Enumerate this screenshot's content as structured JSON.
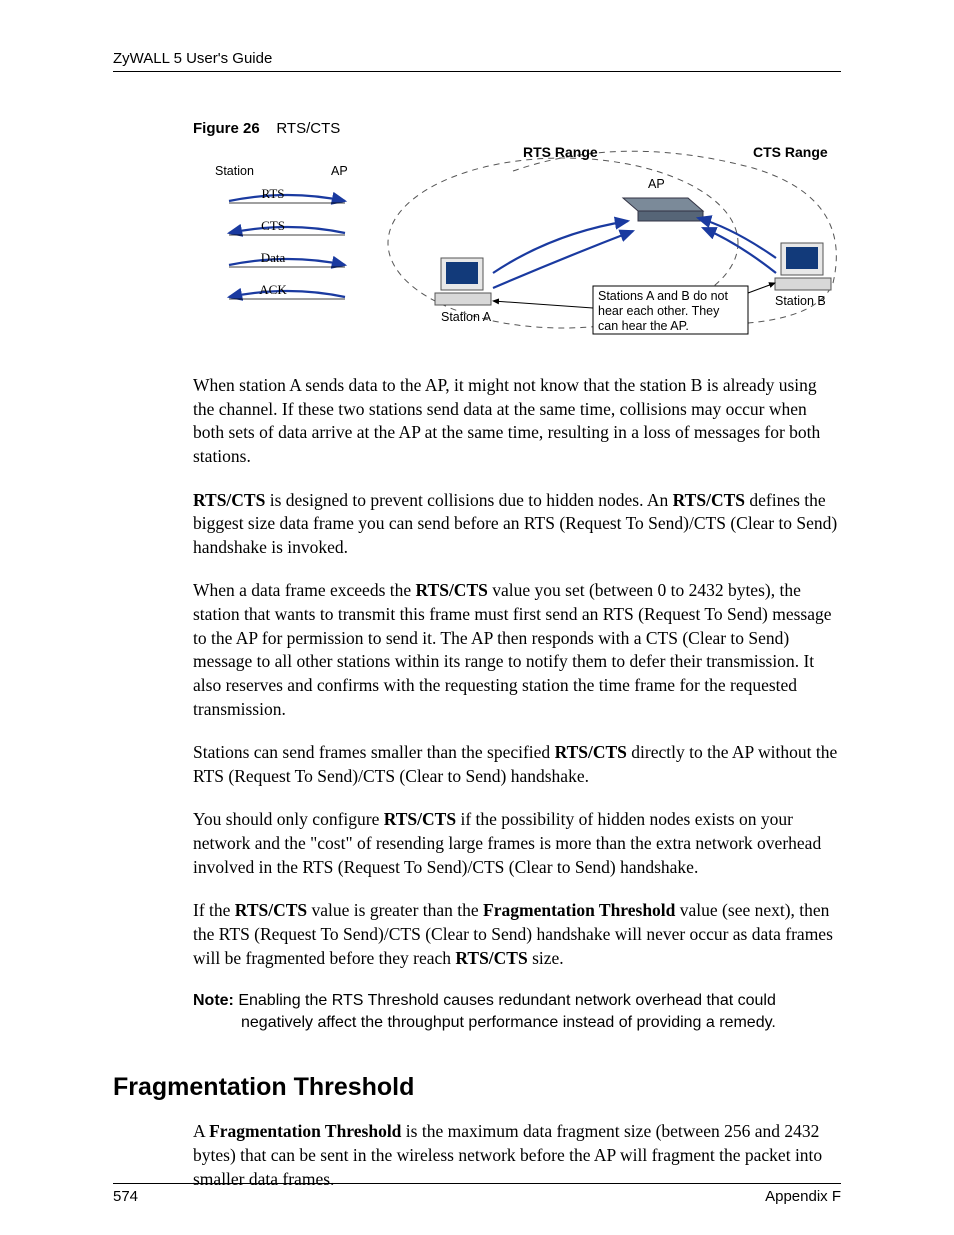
{
  "header": {
    "title": "ZyWALL 5 User's Guide"
  },
  "figure": {
    "label": "Figure 26",
    "title": "RTS/CTS",
    "left": {
      "station": "Station",
      "ap": "AP",
      "seq": [
        "RTS",
        "CTS",
        "Data",
        "ACK"
      ]
    },
    "right": {
      "rts_range": "RTS Range",
      "cts_range": "CTS Range",
      "ap": "AP",
      "station_a": "Station  A",
      "station_b": "Station B",
      "note_l1": "Stations A and B do not",
      "note_l2": "hear each other. They",
      "note_l3": "can hear the AP."
    }
  },
  "paragraphs": {
    "p1": "When station A sends data to the AP, it might not know that the station B is already using the channel. If these two stations send data at the same time, collisions may occur when both sets of data arrive at the AP at the same time, resulting in a loss of messages for both stations.",
    "p2a": "RTS/CTS",
    "p2b": " is designed to prevent collisions due to hidden nodes. An ",
    "p2c": "RTS/CTS",
    "p2d": " defines the biggest size data frame you can send before an RTS (Request To Send)/CTS (Clear to Send) handshake is invoked.",
    "p3a": "When a data frame exceeds the ",
    "p3b": "RTS/CTS",
    "p3c": " value you set (between 0 to 2432 bytes), the station that wants to transmit this frame must first send an RTS (Request To Send) message to the AP for permission to send it. The AP then responds with a CTS (Clear to Send) message to all other stations within its range to notify them to defer their transmission. It also reserves and confirms with the requesting station the time frame for the requested transmission.",
    "p4a": "Stations can send frames smaller than the specified ",
    "p4b": "RTS/CTS",
    "p4c": " directly to the AP without the RTS (Request To Send)/CTS (Clear to Send) handshake.",
    "p5a": "You should only configure ",
    "p5b": "RTS/CTS",
    "p5c": " if the possibility of hidden nodes exists on your network and the \"cost\" of resending large frames is more than the extra network overhead involved in the RTS (Request To Send)/CTS (Clear to Send) handshake.",
    "p6a": "If the ",
    "p6b": "RTS/CTS",
    "p6c": " value is greater than the ",
    "p6d": "Fragmentation Threshold",
    "p6e": " value (see next), then the RTS (Request To Send)/CTS (Clear to Send) handshake will never occur as data frames will be fragmented before they reach ",
    "p6f": "RTS/CTS",
    "p6g": " size.",
    "note_label": "Note: ",
    "note_text": "Enabling the RTS Threshold causes redundant network overhead that could negatively affect the throughput performance instead of providing a remedy."
  },
  "section": {
    "heading": "Fragmentation Threshold",
    "p1a": "A ",
    "p1b": "Fragmentation Threshold",
    "p1c": " is the maximum data fragment size (between 256 and 2432 bytes) that can be sent in the wireless network before the AP will fragment the packet into smaller data frames."
  },
  "footer": {
    "page": "574",
    "appendix": "Appendix F"
  }
}
